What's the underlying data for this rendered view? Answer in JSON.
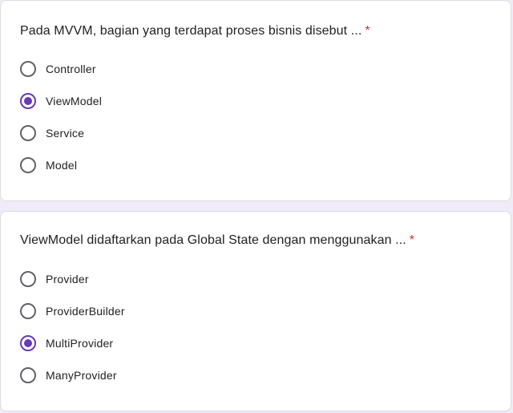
{
  "questions": [
    {
      "title": "Pada MVVM, bagian yang terdapat proses bisnis disebut ...",
      "required_mark": "*",
      "options": [
        {
          "label": "Controller",
          "selected": false
        },
        {
          "label": "ViewModel",
          "selected": true
        },
        {
          "label": "Service",
          "selected": false
        },
        {
          "label": "Model",
          "selected": false
        }
      ]
    },
    {
      "title": "ViewModel didaftarkan pada Global State dengan menggunakan ...",
      "required_mark": "*",
      "options": [
        {
          "label": "Provider",
          "selected": false
        },
        {
          "label": "ProviderBuilder",
          "selected": false
        },
        {
          "label": "MultiProvider",
          "selected": true
        },
        {
          "label": "ManyProvider",
          "selected": false
        }
      ]
    }
  ],
  "colors": {
    "accent": "#673ab7",
    "required": "#d93025",
    "radio_border": "#5f6368",
    "background": "#f0ebf8"
  }
}
